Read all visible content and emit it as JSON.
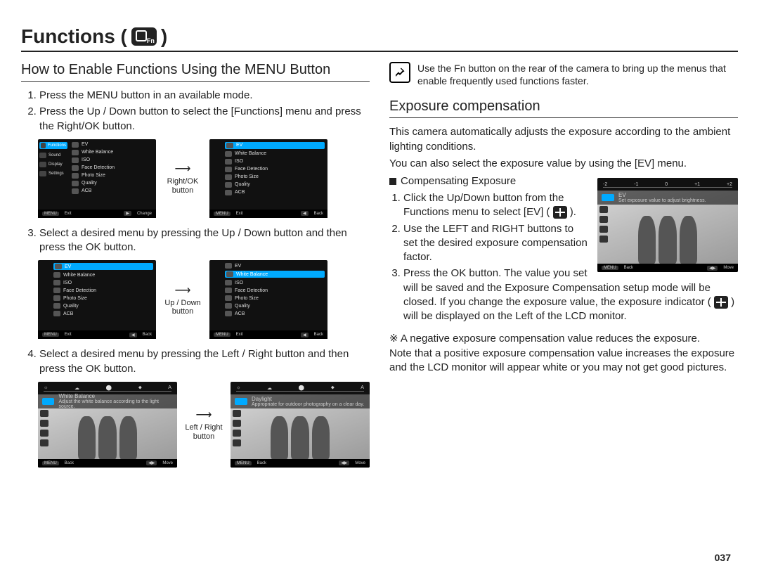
{
  "title": "Functions (",
  "title_close": ")",
  "page_number": "037",
  "left": {
    "heading": "How to Enable Functions Using the MENU Button",
    "steps12": [
      "Press the MENU button in an available mode.",
      "Press the Up / Down button to select the [Functions] menu and press the Right/OK button."
    ],
    "arrow1_label_a": "Right/OK",
    "arrow1_label_b": "button",
    "step3": "Select a desired menu by pressing the Up / Down button and then press the OK button.",
    "arrow2_label_a": "Up / Down",
    "arrow2_label_b": "button",
    "step4": "Select a desired menu by pressing the Left / Right button and then press the OK button.",
    "arrow3_label_a": "Left / Right",
    "arrow3_label_b": "button",
    "lcd_left_menu": [
      "Functions",
      "Sound",
      "Display",
      "Settings"
    ],
    "lcd_right_menu": [
      "EV",
      "White Balance",
      "ISO",
      "Face Detection",
      "Photo Size",
      "Quality",
      "ACB"
    ],
    "lcd_bar1_left": "Exit",
    "lcd_bar1_right": "Change",
    "lcd_bar2_right": "Back",
    "lcd_wb_title": "White Balance",
    "lcd_wb_desc": "Adjust the white balance according to the light source.",
    "lcd_daylight_title": "Daylight",
    "lcd_daylight_desc": "Appropriate for outdoor photography on a clear day.",
    "lcd_bar3_left": "Back",
    "lcd_bar3_right": "Move",
    "menu_btn": "MENU"
  },
  "right": {
    "note": "Use the Fn button on the rear of the camera to bring up the menus that enable frequently used functions faster.",
    "heading": "Exposure compensation",
    "intro1": "This camera automatically adjusts the exposure according to the ambient lighting conditions.",
    "intro2": "You can also select the exposure value by using the [EV] menu.",
    "comp_title": "Compensating Exposure",
    "comp_steps_1a": "Click the Up/Down button from the Functions menu to select [EV] (",
    "comp_steps_1b": ").",
    "comp_steps_2": "Use the LEFT and RIGHT buttons to set the desired exposure compensation factor.",
    "comp_steps_3a": "Press the OK button. The value you set will be saved and the Exposure Compensation setup mode will be closed. If you change the exposure value, the exposure indicator (",
    "comp_steps_3b": ") will be displayed on the Left of the LCD monitor.",
    "foot_star": "※",
    "foot_a": "A negative exposure compensation value reduces the exposure.",
    "foot_b": "Note that a positive exposure compensation value increases the exposure and the LCD monitor will appear white or you may not get good pictures.",
    "ev_scale": [
      "-2",
      "-1",
      "0",
      "+1",
      "+2"
    ],
    "ev_strip1": "EV",
    "ev_strip2": "Set exposure value to adjust brightness.",
    "ev_bar_left": "Back",
    "ev_bar_right": "Move"
  }
}
